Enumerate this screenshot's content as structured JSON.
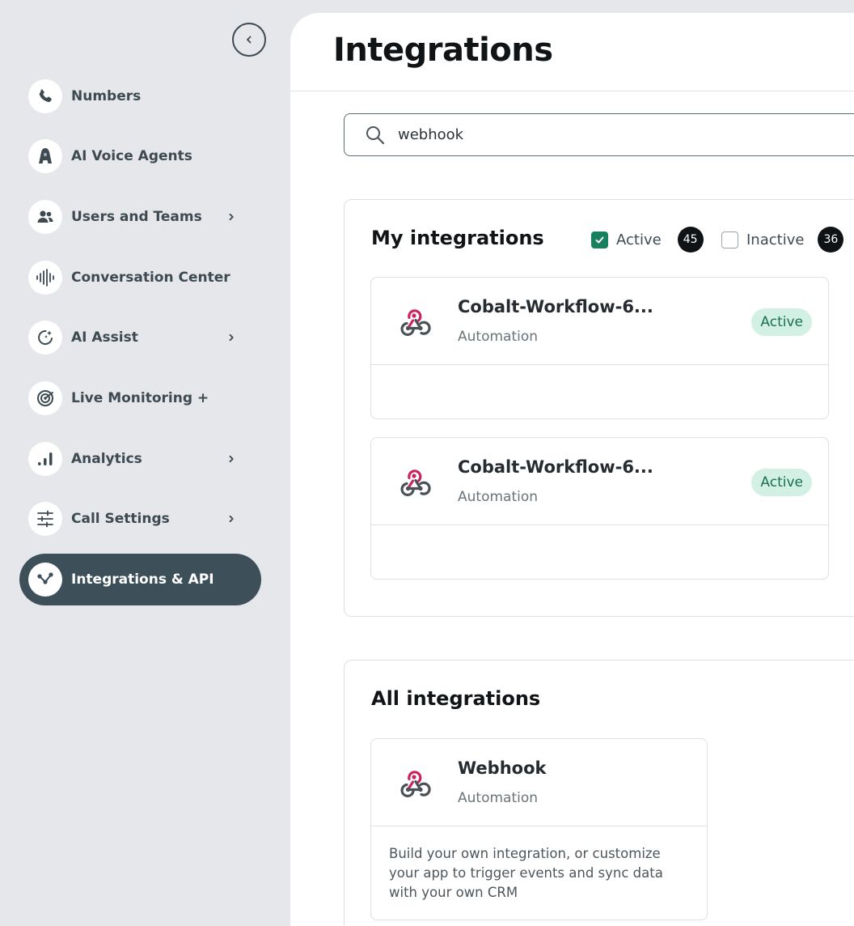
{
  "sidebar": {
    "collapse_label": "collapse",
    "items": [
      {
        "label": "Numbers",
        "icon": "phone-icon"
      },
      {
        "label": "AI Voice Agents",
        "icon": "ai-agent-icon"
      },
      {
        "label": "Users and Teams",
        "icon": "users-icon",
        "chevron": true
      },
      {
        "label": "Conversation Center",
        "icon": "waveform-icon"
      },
      {
        "label": "AI Assist",
        "icon": "ai-assist-icon",
        "chevron": true
      },
      {
        "label": "Live Monitoring +",
        "icon": "monitoring-icon"
      },
      {
        "label": "Analytics",
        "icon": "analytics-icon",
        "chevron": true
      },
      {
        "label": "Call Settings",
        "icon": "sliders-icon",
        "chevron": true
      },
      {
        "label": "Integrations & API",
        "icon": "integrations-icon",
        "active": true
      }
    ]
  },
  "header": {
    "title": "Integrations"
  },
  "search": {
    "value": "webhook",
    "placeholder": ""
  },
  "my_integrations": {
    "title": "My integrations",
    "filters": {
      "active": {
        "label": "Active",
        "count": "45",
        "checked": true
      },
      "inactive": {
        "label": "Inactive",
        "count": "36",
        "checked": false
      }
    },
    "cards": [
      {
        "name": "Cobalt-Workflow-6...",
        "category": "Automation",
        "status": "Active",
        "logo": "webhook-icon"
      },
      {
        "name": "Cobalt-Workflow-6...",
        "category": "Automation",
        "status": "Active",
        "logo": "webhook-icon"
      }
    ]
  },
  "all_integrations": {
    "title": "All integrations",
    "cards": [
      {
        "name": "Webhook",
        "category": "Automation",
        "description": "Build your own integration, or customize your app to trigger events and sync data with your own CRM",
        "logo": "webhook-icon"
      }
    ]
  },
  "colors": {
    "sidebar_bg": "#e6e7ea",
    "active_nav_bg": "#3d4f59",
    "checkbox_green": "#17805e",
    "status_pill_bg": "#d3f0e4",
    "status_pill_text": "#18714f",
    "webhook_pink": "#c8245e",
    "webhook_gray": "#4a5258"
  }
}
